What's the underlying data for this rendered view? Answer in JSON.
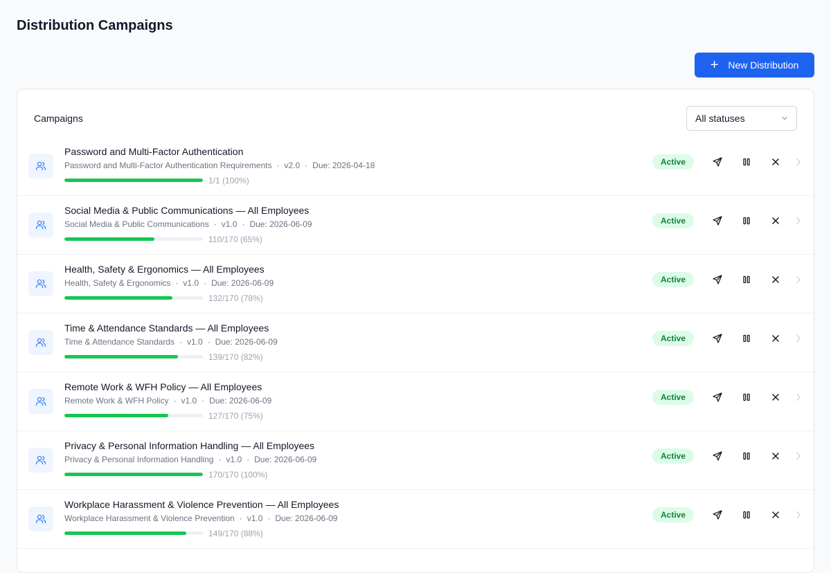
{
  "page": {
    "title": "Distribution Campaigns"
  },
  "toolbar": {
    "new_label": "New Distribution"
  },
  "campaigns": {
    "title": "Campaigns",
    "filter": {
      "selected": "All statuses"
    },
    "rows": [
      {
        "title": "Password and Multi-Factor Authentication",
        "policy": "Password and Multi-Factor Authentication Requirements",
        "version": "v2.0",
        "due": "Due: 2026-04-18",
        "progress_text": "1/1 (100%)",
        "progress": 1.0,
        "status": "Active"
      },
      {
        "title": "Social Media & Public Communications — All Employees",
        "policy": "Social Media & Public Communications",
        "version": "v1.0",
        "due": "Due: 2026-06-09",
        "progress_text": "110/170 (65%)",
        "progress": 0.65,
        "status": "Active"
      },
      {
        "title": "Health, Safety & Ergonomics — All Employees",
        "policy": "Health, Safety & Ergonomics",
        "version": "v1.0",
        "due": "Due: 2026-06-09",
        "progress_text": "132/170 (78%)",
        "progress": 0.78,
        "status": "Active"
      },
      {
        "title": "Time & Attendance Standards — All Employees",
        "policy": "Time & Attendance Standards",
        "version": "v1.0",
        "due": "Due: 2026-06-09",
        "progress_text": "139/170 (82%)",
        "progress": 0.82,
        "status": "Active"
      },
      {
        "title": "Remote Work & WFH Policy — All Employees",
        "policy": "Remote Work & WFH Policy",
        "version": "v1.0",
        "due": "Due: 2026-06-09",
        "progress_text": "127/170 (75%)",
        "progress": 0.75,
        "status": "Active"
      },
      {
        "title": "Privacy & Personal Information Handling — All Employees",
        "policy": "Privacy & Personal Information Handling",
        "version": "v1.0",
        "due": "Due: 2026-06-09",
        "progress_text": "170/170 (100%)",
        "progress": 1.0,
        "status": "Active"
      },
      {
        "title": "Workplace Harassment & Violence Prevention — All Employees",
        "policy": "Workplace Harassment & Violence Prevention",
        "version": "v1.0",
        "due": "Due: 2026-06-09",
        "progress_text": "149/170 (88%)",
        "progress": 0.88,
        "status": "Active"
      }
    ]
  },
  "colors": {
    "accent": "#1d63f0",
    "progress": "#16c653",
    "badge_bg": "#dcfce7",
    "badge_text": "#15803d"
  },
  "icons": {
    "row": "users-icon",
    "send": "send-icon",
    "pause": "pause-icon",
    "cancel": "close-icon",
    "open": "chevron-right-icon",
    "add": "plus-icon",
    "dropdown": "chevron-down-icon"
  }
}
